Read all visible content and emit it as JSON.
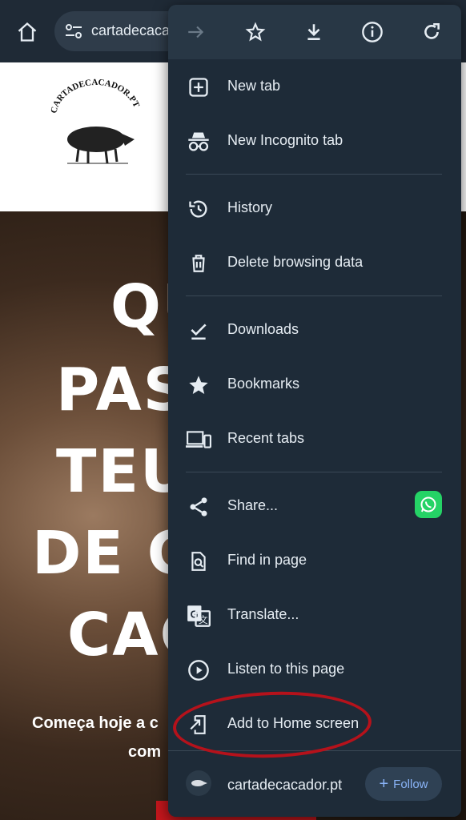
{
  "browser": {
    "url": "cartadecacador.pt",
    "toolbar_icons": [
      "forward-icon",
      "star-icon",
      "download-icon",
      "info-icon",
      "reload-icon"
    ]
  },
  "page": {
    "logo_text": "CARTADECACADOR.PT",
    "hero_lines": [
      "QU",
      "PAS",
      "TEU",
      "DE C",
      "CAÇ"
    ],
    "subtitle_line1": "Começa hoje a c",
    "subtitle_line2": "com"
  },
  "menu": {
    "items": [
      {
        "label": "New tab",
        "icon": "new-tab-icon"
      },
      {
        "label": "New Incognito tab",
        "icon": "incognito-icon"
      },
      {
        "label": "History",
        "icon": "history-icon"
      },
      {
        "label": "Delete browsing data",
        "icon": "trash-icon"
      },
      {
        "label": "Downloads",
        "icon": "downloads-icon"
      },
      {
        "label": "Bookmarks",
        "icon": "bookmark-star-icon"
      },
      {
        "label": "Recent tabs",
        "icon": "devices-icon"
      },
      {
        "label": "Share...",
        "icon": "share-icon"
      },
      {
        "label": "Find in page",
        "icon": "find-icon"
      },
      {
        "label": "Translate...",
        "icon": "translate-icon"
      },
      {
        "label": "Listen to this page",
        "icon": "play-circle-icon"
      },
      {
        "label": "Add to Home screen",
        "icon": "add-to-home-icon"
      }
    ],
    "site": {
      "label": "cartadecacador.pt",
      "follow_label": "Follow"
    }
  },
  "colors": {
    "menu_bg": "#1e2b38",
    "accent": "#8ab4f8",
    "annotation": "#b5121b",
    "whatsapp": "#25d366"
  }
}
